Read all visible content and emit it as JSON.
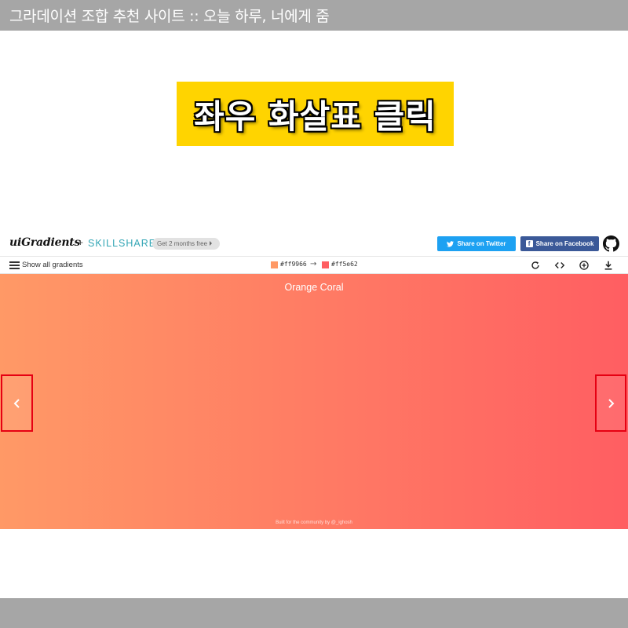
{
  "page_title": "그라데이션 조합 추천 사이트 :: 오늘 하루, 너에게 줌",
  "banner": {
    "text": "좌우 화살표 클릭"
  },
  "header": {
    "logo": "uiGradients",
    "plus": "+",
    "partner": "SKILLSHARE",
    "promo": "Get 2 months free",
    "share_twitter": "Share on Twitter",
    "share_facebook": "Share on Facebook",
    "facebook_glyph": "f"
  },
  "toolbar": {
    "show_all": "Show all gradients",
    "color_from": "#ff9966",
    "arrow": "→",
    "color_to": "#ff5e62"
  },
  "gradient": {
    "name": "Orange Coral",
    "credit": "Built for the community by @_ighosh"
  },
  "colors": {
    "gradient_start": "#ff9966",
    "gradient_end": "#ff5e62",
    "banner_bg": "#ffd400",
    "highlight_border": "#e60012",
    "twitter_blue": "#1da1f2",
    "facebook_blue": "#3b5998",
    "frame_gray": "#a6a6a6"
  }
}
